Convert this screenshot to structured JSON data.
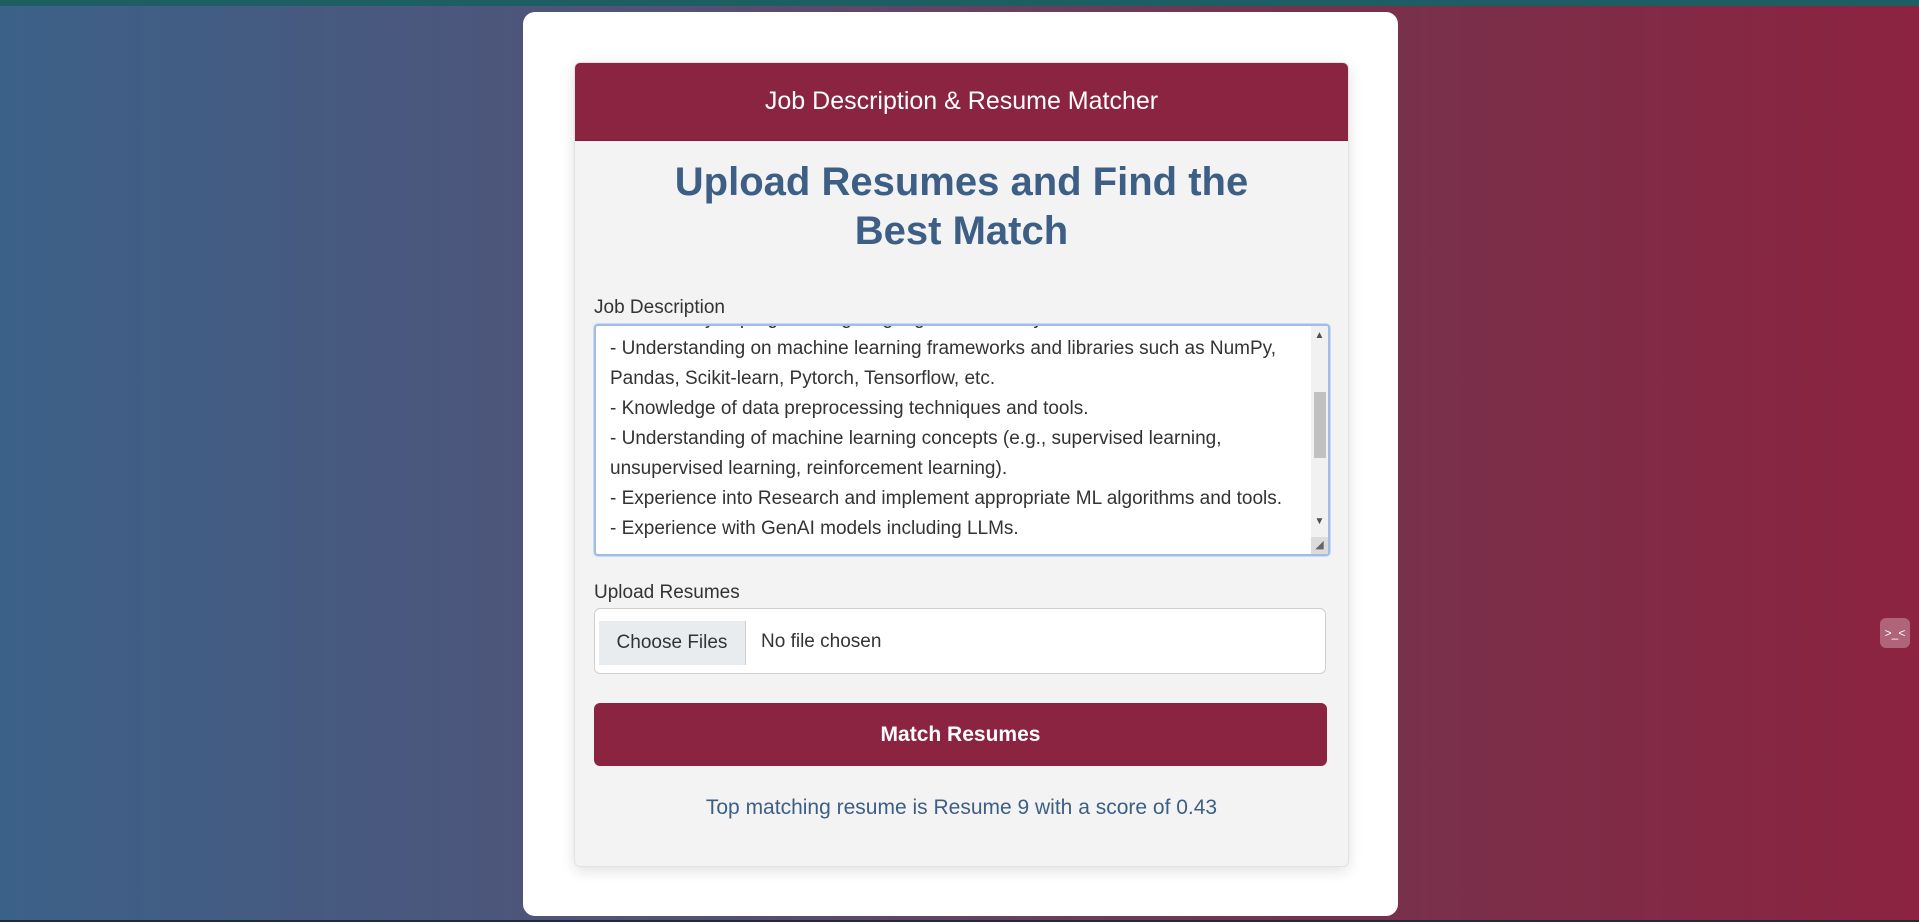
{
  "header": {
    "title": "Job Description & Resume Matcher"
  },
  "main": {
    "heading": "Upload Resumes and Find the Best Match",
    "job_description": {
      "label": "Job Description",
      "value": "- Proficiency in programming languages such as Python.\n- Understanding on machine learning frameworks and libraries such as NumPy, Pandas, Scikit-learn, Pytorch, Tensorflow, etc.\n- Knowledge of data preprocessing techniques and tools.\n- Understanding of machine learning concepts (e.g., supervised learning, unsupervised learning, reinforcement learning).\n- Experience into Research and implement appropriate ML algorithms and tools.\n- Experience with GenAI models including LLMs."
    },
    "upload": {
      "label": "Upload Resumes",
      "button_label": "Choose Files",
      "status": "No file chosen"
    },
    "submit_label": "Match Resumes",
    "result": "Top matching resume is Resume 9 with a score of 0.43"
  },
  "scrollbar": {
    "up_arrow": "▲",
    "down_arrow": "▼"
  },
  "widget": {
    "icon": "terminal-icon",
    "glyph": ">_<"
  },
  "colors": {
    "accent": "#8b2441",
    "heading": "#3d5f85",
    "gradient_left": "#3c6189",
    "gradient_right": "#8c2340"
  }
}
